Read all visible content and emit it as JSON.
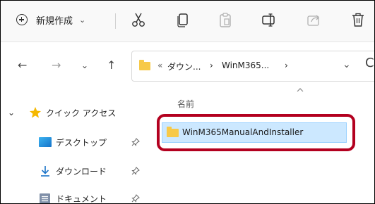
{
  "toolbar": {
    "new_label": "新規作成",
    "new_caret": "⌄",
    "icons": [
      "new-icon",
      "cut-icon",
      "copy-icon",
      "paste-icon",
      "rename-icon",
      "share-icon",
      "delete-icon"
    ]
  },
  "nav": {
    "back": "←",
    "forward": "→",
    "recent": "⌄",
    "up": "↑"
  },
  "address": {
    "prefix": "«",
    "crumb1": "ダウン...",
    "sep1": "›",
    "crumb2": "WinM365...",
    "sep2": "›",
    "chevron": "⌄",
    "refresh": "C"
  },
  "sidebar": {
    "items": [
      {
        "label": "クイック アクセス",
        "icon": "star-icon"
      },
      {
        "label": "デスクトップ",
        "icon": "desktop-icon"
      },
      {
        "label": "ダウンロード",
        "icon": "download-icon"
      },
      {
        "label": "ドキュメント",
        "icon": "documents-icon"
      }
    ],
    "expand": "⌄"
  },
  "file_list": {
    "column_name": "名前",
    "items": [
      {
        "name": "WinM365ManualAndInstaller",
        "icon": "folder-icon",
        "selected": true
      }
    ]
  },
  "colors": {
    "selection": "#cce8ff",
    "highlight": "#b3001f",
    "folder": "#f7c948",
    "star": "#f5b800",
    "download": "#1a73c8"
  }
}
